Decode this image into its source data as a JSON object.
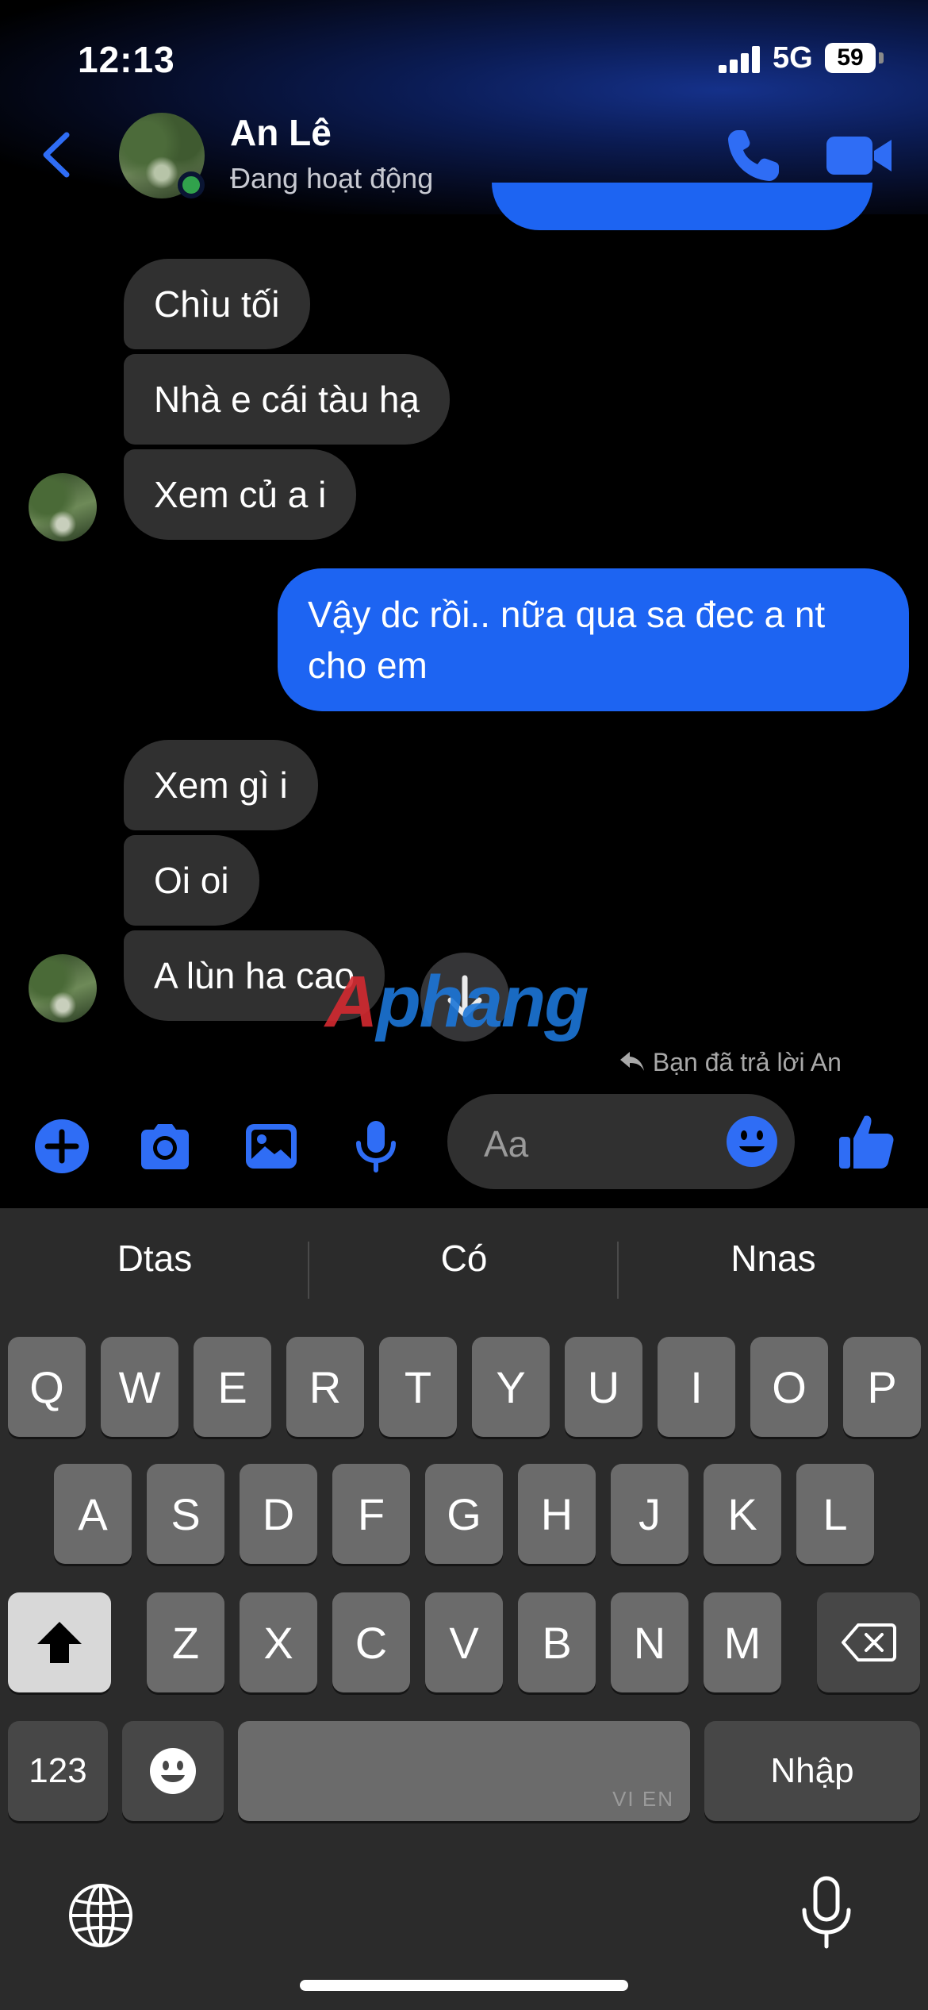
{
  "status_bar": {
    "time": "12:13",
    "network": "5G",
    "battery": "59"
  },
  "header": {
    "name": "An Lê",
    "status": "Đang hoạt động",
    "back_icon": "chevron-left-icon",
    "call_icon": "phone-icon",
    "video_icon": "video-camera-icon",
    "accent": "#1d64f2"
  },
  "messages": [
    {
      "side": "in",
      "text": "Chìu tối"
    },
    {
      "side": "in",
      "text": "Nhà e cái tàu hạ"
    },
    {
      "side": "in",
      "text": "Xem củ a i"
    },
    {
      "side": "out",
      "text": "Vậy dc rồi.. nữa qua sa đec a nt cho em"
    },
    {
      "side": "in",
      "text": "Xem gì i"
    },
    {
      "side": "in",
      "text": "Oi oi"
    },
    {
      "side": "in",
      "text": "A lùn ha cao"
    }
  ],
  "reply_note": "Bạn đã trả lời An",
  "watermark": {
    "part1": "A",
    "part2": "phang"
  },
  "composer": {
    "placeholder": "Aa",
    "icons": [
      "plus-circle-icon",
      "camera-icon",
      "photo-icon",
      "microphone-icon",
      "emoji-icon",
      "thumbs-up-icon"
    ]
  },
  "keyboard": {
    "suggestions": [
      "Dtas",
      "Có",
      "Nnas"
    ],
    "row1": [
      "Q",
      "W",
      "E",
      "R",
      "T",
      "Y",
      "U",
      "I",
      "O",
      "P"
    ],
    "row2": [
      "A",
      "S",
      "D",
      "F",
      "G",
      "H",
      "J",
      "K",
      "L"
    ],
    "row3": [
      "Z",
      "X",
      "C",
      "V",
      "B",
      "N",
      "M"
    ],
    "numbers_key": "123",
    "return_key": "Nhập",
    "space_languages": "VI EN"
  }
}
